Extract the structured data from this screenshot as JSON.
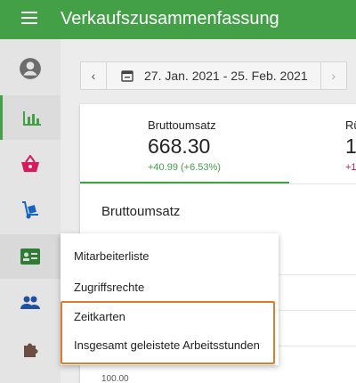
{
  "app": {
    "title": "Verkaufszusammenfassung"
  },
  "colors": {
    "brand": "#43a047",
    "highlight": "#e07d2c",
    "positive": "#43a047",
    "negative": "#c2185b"
  },
  "sidebar": {
    "items": [
      {
        "icon": "account-circle-icon",
        "active": false
      },
      {
        "icon": "bar-chart-icon",
        "active": true
      },
      {
        "icon": "shopping-basket-icon",
        "active": false
      },
      {
        "icon": "hand-truck-icon",
        "active": false
      },
      {
        "icon": "employee-card-icon",
        "active": false,
        "hovered": true
      },
      {
        "icon": "people-icon",
        "active": false
      },
      {
        "icon": "puzzle-piece-icon",
        "active": false
      }
    ]
  },
  "date_range": {
    "prev": "‹",
    "label": "27. Jan. 2021 - 25. Feb. 2021",
    "next": "›"
  },
  "metrics": [
    {
      "label": "Bruttoumsatz",
      "value": "668.30",
      "change": "+40.99 (+6.53%)"
    },
    {
      "label": "Rü",
      "value": "1",
      "change": "+1"
    }
  ],
  "card": {
    "title": "Bruttoumsatz",
    "axis_label": "100.00"
  },
  "menu": {
    "items": [
      "Mitarbeiterliste",
      "Zugriffsrechte",
      "Zeitkarten",
      "Insgesamt geleistete Arbeitsstunden"
    ]
  }
}
